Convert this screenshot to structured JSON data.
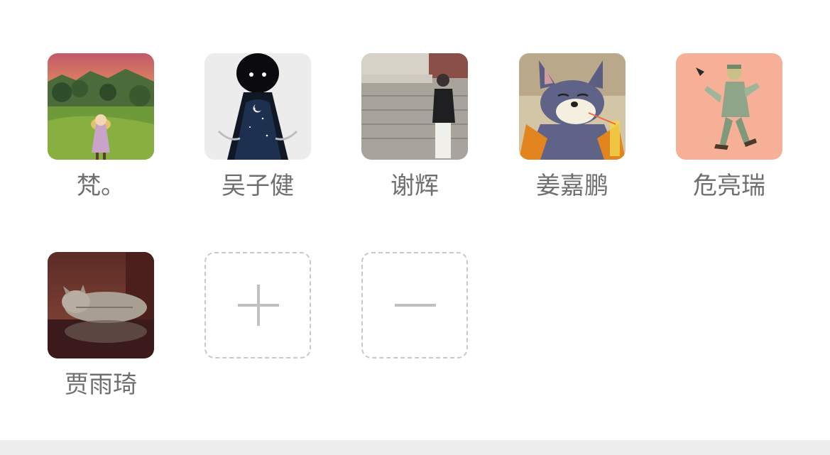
{
  "members": [
    {
      "name": "梵。",
      "avatar_icon": "anime-girl-meadow-sunset-avatar"
    },
    {
      "name": "吴子健",
      "avatar_icon": "silhouette-starry-sky-avatar"
    },
    {
      "name": "谢辉",
      "avatar_icon": "person-by-stone-wall-avatar"
    },
    {
      "name": "姜嘉鹏",
      "avatar_icon": "cartoon-cat-drinking-avatar"
    },
    {
      "name": "危亮瑞",
      "avatar_icon": "illustrated-figure-peach-avatar"
    },
    {
      "name": "贾雨琦",
      "avatar_icon": "sleeping-cat-avatar"
    }
  ],
  "actions": {
    "add_icon": "plus-icon",
    "remove_icon": "minus-icon"
  },
  "colors": {
    "name_text": "#6f6f6f",
    "dashed_border": "#c8c8c8",
    "action_glyph": "#c0c0c0",
    "bottom_bar": "#ededed"
  }
}
